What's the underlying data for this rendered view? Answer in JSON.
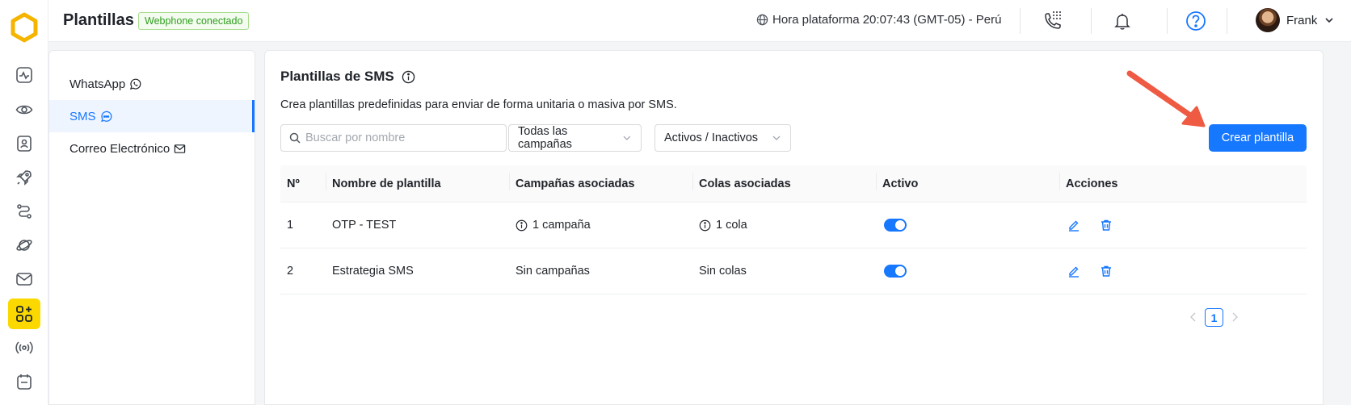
{
  "header": {
    "title": "Plantillas",
    "webphone_badge": "Webphone conectado",
    "clock_text": "Hora plataforma 20:07:43 (GMT-05) - Perú",
    "user_name": "Frank"
  },
  "rail": {
    "icons": [
      "dashboard-icon",
      "monitor-eye-icon",
      "contacts-icon",
      "rocket-icon",
      "flows-icon",
      "planet-icon",
      "mail-icon",
      "apps-add-icon",
      "broadcast-icon",
      "calendar-icon"
    ],
    "active": "apps-add-icon",
    "accent": "#fbd900"
  },
  "subnav": {
    "items": [
      {
        "label": "WhatsApp",
        "icon": "whatsapp-icon",
        "active": false
      },
      {
        "label": "SMS",
        "icon": "chat-bubble-icon",
        "active": true
      },
      {
        "label": "Correo Electrónico",
        "icon": "mail-icon",
        "active": false
      }
    ]
  },
  "main": {
    "title": "Plantillas de SMS",
    "description": "Crea plantillas predefinidas para enviar de forma unitaria o masiva por SMS.",
    "search_placeholder": "Buscar por nombre",
    "campaign_filter": "Todas las campañas",
    "status_filter": "Activos / Inactivos",
    "create_button": "Crear plantilla",
    "primary_color": "#1677ff"
  },
  "table": {
    "columns": [
      "Nº",
      "Nombre de plantilla",
      "Campañas asociadas",
      "Colas asociadas",
      "Activo",
      "Acciones"
    ],
    "rows": [
      {
        "num": "1",
        "name": "OTP - TEST",
        "campaigns": "1 campaña",
        "queues": "1 cola",
        "active": true
      },
      {
        "num": "2",
        "name": "Estrategia SMS",
        "campaigns": "Sin campañas",
        "queues": "Sin colas",
        "active": true
      }
    ]
  },
  "pagination": {
    "current": "1"
  }
}
